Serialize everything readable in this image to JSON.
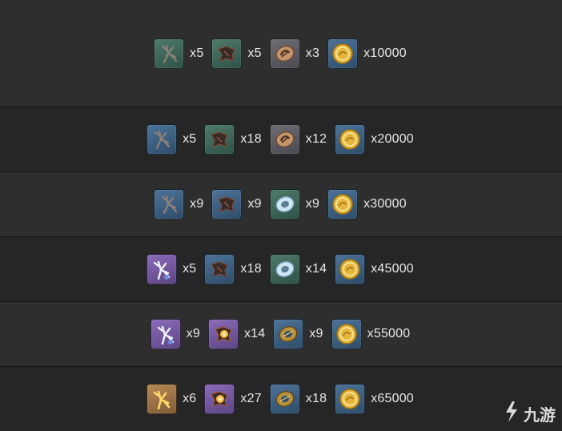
{
  "rows": [
    {
      "items": [
        {
          "icon": "branch-icon",
          "tier": "green",
          "qty": "x5"
        },
        {
          "icon": "claw-icon",
          "tier": "green",
          "qty": "x5"
        },
        {
          "icon": "shell-icon",
          "tier": "grey",
          "qty": "x3"
        },
        {
          "icon": "mora-coin-icon",
          "tier": "blue",
          "qty": "x10000"
        }
      ]
    },
    {
      "items": [
        {
          "icon": "branch-icon",
          "tier": "blue",
          "qty": "x5"
        },
        {
          "icon": "claw-icon",
          "tier": "green",
          "qty": "x18"
        },
        {
          "icon": "shell-icon",
          "tier": "grey",
          "qty": "x12"
        },
        {
          "icon": "mora-coin-icon",
          "tier": "blue",
          "qty": "x20000"
        }
      ]
    },
    {
      "items": [
        {
          "icon": "branch-icon",
          "tier": "blue",
          "qty": "x9"
        },
        {
          "icon": "claw-icon",
          "tier": "blue",
          "qty": "x9"
        },
        {
          "icon": "crystal-ring-icon",
          "tier": "green",
          "qty": "x9"
        },
        {
          "icon": "mora-coin-icon",
          "tier": "blue",
          "qty": "x30000"
        }
      ]
    },
    {
      "items": [
        {
          "icon": "coral-icon",
          "tier": "purple",
          "qty": "x5"
        },
        {
          "icon": "claw-icon",
          "tier": "blue",
          "qty": "x18"
        },
        {
          "icon": "crystal-ring-icon",
          "tier": "green",
          "qty": "x14"
        },
        {
          "icon": "mora-coin-icon",
          "tier": "blue",
          "qty": "x45000"
        }
      ]
    },
    {
      "items": [
        {
          "icon": "coral-icon",
          "tier": "purple",
          "qty": "x9"
        },
        {
          "icon": "glowing-claw-icon",
          "tier": "purple",
          "qty": "x14"
        },
        {
          "icon": "gold-ring-icon",
          "tier": "blue",
          "qty": "x9"
        },
        {
          "icon": "mora-coin-icon",
          "tier": "blue",
          "qty": "x55000"
        }
      ]
    },
    {
      "items": [
        {
          "icon": "gold-coral-icon",
          "tier": "gold",
          "qty": "x6"
        },
        {
          "icon": "glowing-claw-icon",
          "tier": "purple",
          "qty": "x27"
        },
        {
          "icon": "gold-ring-icon",
          "tier": "blue",
          "qty": "x18"
        },
        {
          "icon": "mora-coin-icon",
          "tier": "blue",
          "qty": "x65000"
        }
      ]
    }
  ],
  "watermark": {
    "text": "九游",
    "icon": "jiuyou-logo-icon"
  },
  "colors": {
    "row_light": "#2e2e2e",
    "row_dark": "#262626",
    "divider": "#141414",
    "text": "#e8e8e8"
  }
}
